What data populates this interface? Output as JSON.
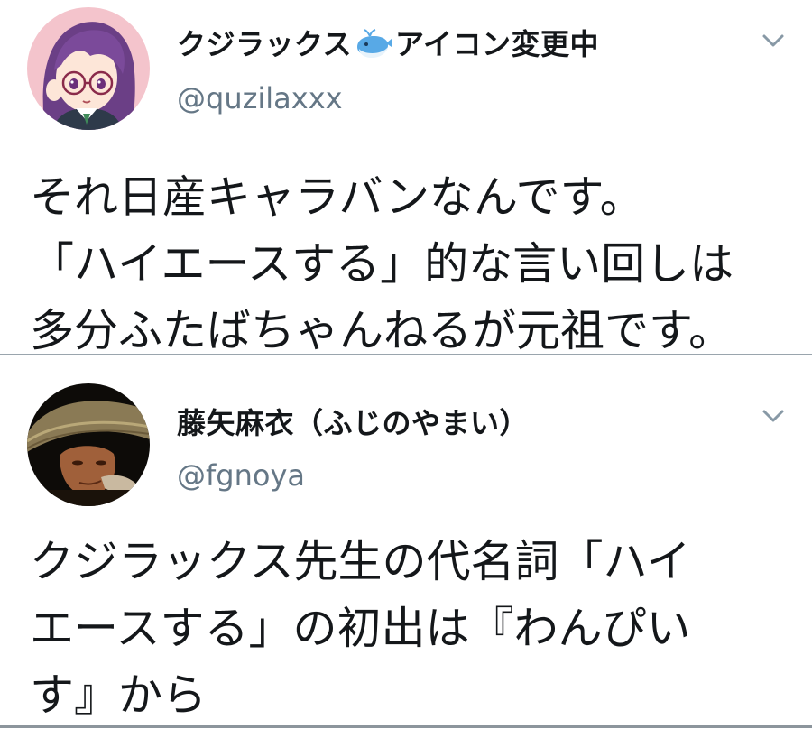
{
  "tweets": [
    {
      "display_name_prefix": "クジラックス",
      "display_name_emoji": "whale-emoji",
      "display_name_suffix": "アイコン変更中",
      "handle": "@quzilaxxx",
      "text_lines": [
        "それ日産キャラバンなんです。",
        "「ハイエースする」的な言い回しは",
        "多分ふたばちゃんねるが元祖です。"
      ]
    },
    {
      "display_name_prefix": "藤矢麻衣（ふじのやまい）",
      "handle": "@fgnoya",
      "text_lines": [
        "クジラックス先生の代名詞「ハイ",
        "エースする」の初出は『わんぴい",
        "す』から"
      ]
    }
  ],
  "icons": {
    "menu": "chevron-down-icon",
    "emoji": "whale-emoji"
  },
  "colors": {
    "text": "#14171a",
    "secondary": "#657786",
    "divider": "#9aa5ad"
  }
}
